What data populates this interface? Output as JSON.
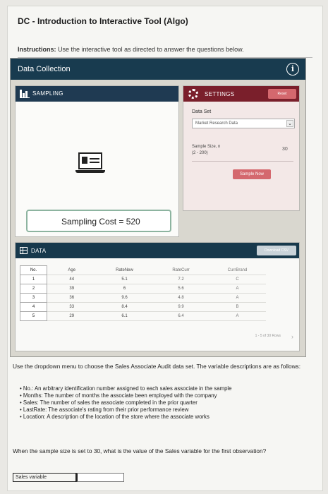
{
  "title": "DC - Introduction to Interactive Tool (Algo)",
  "instructions": {
    "label": "Instructions:",
    "text": "Use the interactive tool as directed to answer the questions below."
  },
  "panel": {
    "title": "Data Collection",
    "info_icon": "i",
    "sampling": {
      "label": "SAMPLING",
      "cost_text": "Sampling Cost = 520"
    },
    "settings": {
      "label": "SETTINGS",
      "reset_label": "Reset",
      "dataset_label": "Data Set",
      "dataset_value": "Market Research Data",
      "sample_size_label": "Sample Size, n",
      "sample_size_range": "(2 - 200)",
      "sample_size_value": "30",
      "sample_button": "Sample Now"
    },
    "data": {
      "label": "DATA",
      "download_label": "Download CSV",
      "columns": [
        "No.",
        "Age",
        "RateNew",
        "RateCurr",
        "CurrBrand"
      ],
      "rows": [
        [
          "1",
          "44",
          "5.1",
          "7.2",
          "C"
        ],
        [
          "2",
          "39",
          "6",
          "5.6",
          "A"
        ],
        [
          "3",
          "36",
          "9.6",
          "4.8",
          "A"
        ],
        [
          "4",
          "33",
          "8.4",
          "9.9",
          "B"
        ],
        [
          "5",
          "29",
          "6.1",
          "6.4",
          "A"
        ]
      ],
      "pagination": "1 - 5 of 30 Rows"
    }
  },
  "description": "Use the dropdown menu to choose the Sales Associate Audit data set. The variable descriptions are as follows:",
  "variables": [
    "No.: An arbitrary identification number assigned to each sales associate in the sample",
    "Months: The number of months the associate been employed with the company",
    "Sales: The number of sales the associate completed in the prior quarter",
    "LastRate: The associate's rating from their prior performance review",
    "Location: A description of the location of the store where the associate works"
  ],
  "question": "When the sample size is set to 30, what is the value of the Sales variable for the first observation?",
  "answer": {
    "label": "Sales variable",
    "value": ""
  }
}
